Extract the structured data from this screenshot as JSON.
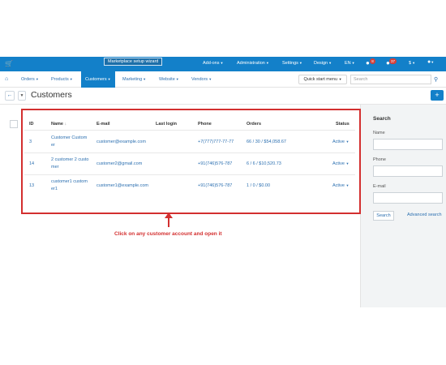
{
  "topbar": {
    "cart_icon": "cart-icon",
    "wizard_label": "Marketplace setup wizard",
    "menus": [
      {
        "label": "Add-ons"
      },
      {
        "label": "Administration"
      },
      {
        "label": "Settings"
      },
      {
        "label": "Design"
      },
      {
        "label": "EN"
      },
      {
        "label": "$"
      }
    ],
    "badge_one": "8",
    "badge_two": "37"
  },
  "nav": {
    "items": [
      {
        "label": "Orders"
      },
      {
        "label": "Products"
      },
      {
        "label": "Customers"
      },
      {
        "label": "Marketing"
      },
      {
        "label": "Website"
      },
      {
        "label": "Vendors"
      }
    ],
    "quick_start": "Quick start menu",
    "search_placeholder": "Search"
  },
  "page": {
    "title": "Customers",
    "add_label": "+"
  },
  "table": {
    "headers": {
      "id": "ID",
      "name": "Name",
      "name_sort": "↓",
      "email": "E-mail",
      "last_login": "Last login",
      "phone": "Phone",
      "orders": "Orders",
      "status": "Status"
    },
    "rows": [
      {
        "id": "3",
        "name_line1": "Customer Custom",
        "name_line2": "er",
        "email": "customer@example.com",
        "phone": "+7(777)777-77-77",
        "orders": "66 / 30 / $54,058.67",
        "status": "Active"
      },
      {
        "id": "14",
        "name_line1": "2 customer 2 custo",
        "name_line2": "mer",
        "email": "customer2@gmail.com",
        "phone": "+91(746)576-787",
        "orders": "6 / 6 / $10,520.73",
        "status": "Active"
      },
      {
        "id": "13",
        "name_line1": "customer1 custom",
        "name_line2": "er1",
        "email": "customer1@example.com",
        "phone": "+91(746)576-787",
        "orders": "1 / 0 / $0.00",
        "status": "Active"
      }
    ]
  },
  "sidebar": {
    "title": "Search",
    "name_label": "Name",
    "phone_label": "Phone",
    "email_label": "E-mail",
    "search_button": "Search",
    "advanced_search": "Advanced search"
  },
  "annotation": {
    "text": "Click on any customer account and open it",
    "color": "#d32f2f"
  },
  "colors": {
    "brand": "#1380c9",
    "link": "#2b6fb0"
  }
}
